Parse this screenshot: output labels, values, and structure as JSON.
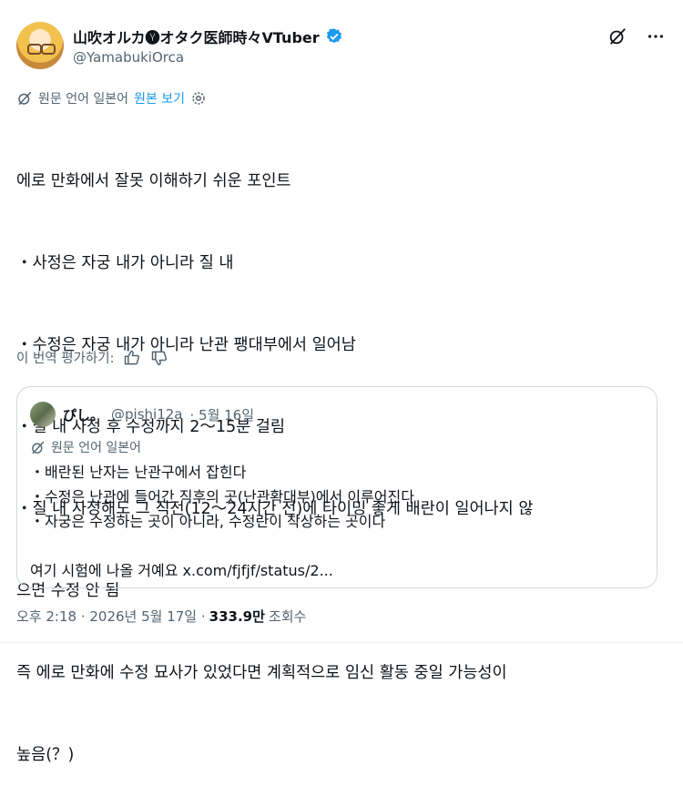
{
  "author": {
    "display_name": "山吹オルカ🅨オタク医師時々VTuber",
    "handle": "@YamabukiOrca"
  },
  "icons": [
    "verified-badge-icon",
    "grok-icon",
    "more-icon",
    "translate-icon",
    "gear-icon",
    "thumbs-up-icon",
    "thumbs-down-icon"
  ],
  "colors": {
    "accent": "#1d9bf0",
    "muted": "#536471",
    "text": "#0f1419",
    "border": "#cfd9de"
  },
  "translation": {
    "source_label": "원문 언어 일본어",
    "show_original_label": "원본 보기"
  },
  "tweet": {
    "lines": [
      "에로 만화에서 잘못 이해하기 쉬운 포인트",
      "・사정은 자궁 내가 아니라 질 내",
      "・수정은 자궁 내가 아니라 난관 팽대부에서 일어남",
      "・질 내 사정 후 수정까지 2〜15분 걸림",
      "・질 내 사정해도 그 직전(12〜24시간 전)에 타이밍 좋게 배란이 일어나지 않",
      "으면 수정 안 됨",
      "즉 에로 만화에 수정 묘사가 있었다면 계획적으로 임신 활동 중일 가능성이",
      "높음(？)"
    ]
  },
  "rate_translation_label": "이 번역 평가하기:",
  "quote": {
    "display_name": "ぴし。",
    "handle": "@pishi12a",
    "date": "· 5월 16일",
    "translate_label": "원문 언어 일본어",
    "lines": [
      "・배란된 난자는 난관구에서 잡힌다",
      "・수정은 난관에 들어간 직후의 곳(난관확대부)에서 이루어진다",
      "・자궁은 수정하는 곳이 아니라, 수정란이 착상하는 곳이다",
      "",
      "여기 시험에 나올 거예요 x.com/fjfjf/status/2..."
    ]
  },
  "footer": {
    "time": "오후 2:18 · 2026년 5월 17일 ·",
    "views": "333.9만",
    "views_label": "조회수"
  }
}
